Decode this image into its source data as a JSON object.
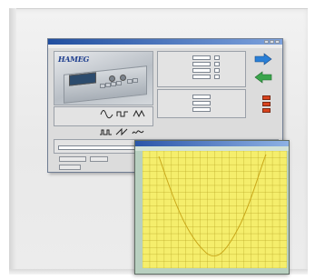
{
  "colors": {
    "plot_background": "#f5ee6c",
    "grid_line": "#b9a826",
    "trace": "#c9a81a",
    "title_bar": "#2a56a8",
    "indicator": "#d9431e",
    "arrow_blue": "#2a7fd6",
    "arrow_green": "#3aa54c"
  },
  "main_window": {
    "device_brand": "HAMEG",
    "arrows": [
      "arrow-right-icon",
      "arrow-left-icon"
    ],
    "indicator_count": 4
  },
  "graph_window": {
    "icons": [
      "plot-grid-icon"
    ]
  }
}
